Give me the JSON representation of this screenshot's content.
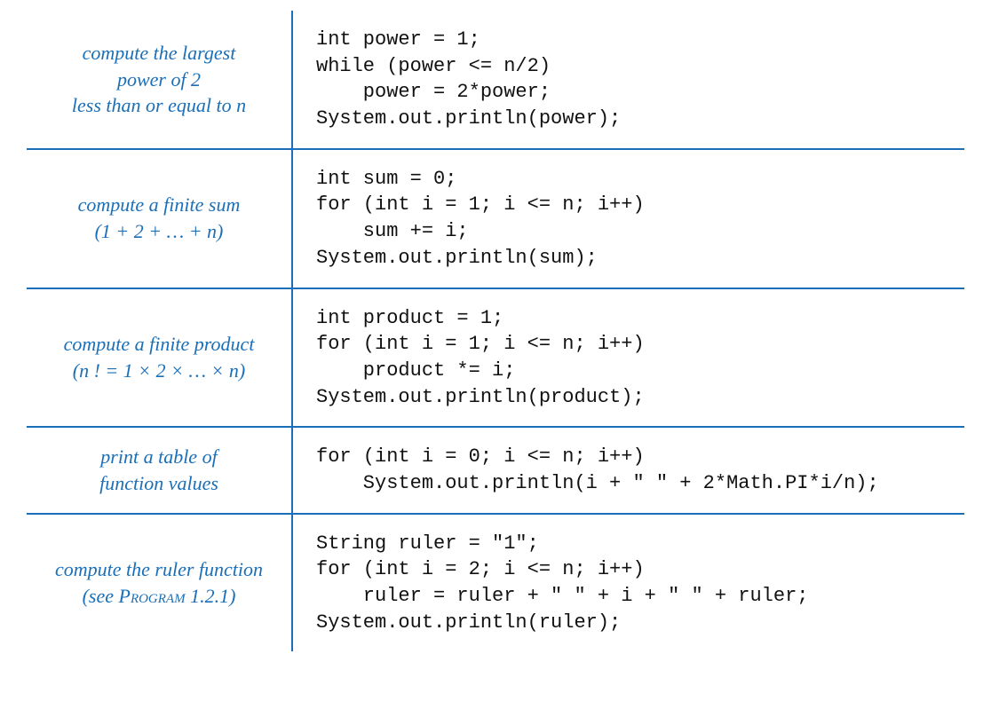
{
  "rows": [
    {
      "desc_html": "compute the largest<br>power of 2<br>less than or equal to n",
      "code": "int power = 1;\nwhile (power <= n/2)\n    power = 2*power;\nSystem.out.println(power);"
    },
    {
      "desc_html": "compute a finite sum<br>(1 + 2 + … + n)",
      "code": "int sum = 0;\nfor (int i = 1; i <= n; i++)\n    sum += i;\nSystem.out.println(sum);"
    },
    {
      "desc_html": "compute a finite product<br>(n ! = 1 × 2 ×  …  × n)",
      "code": "int product = 1;\nfor (int i = 1; i <= n; i++)\n    product *= i;\nSystem.out.println(product);"
    },
    {
      "desc_html": "print a table of<br>function values",
      "code": "for (int i = 0; i <= n; i++)\n    System.out.println(i + \" \" + 2*Math.PI*i/n);"
    },
    {
      "desc_html": "compute the ruler function<br>(see <span class=\"smallcaps\">Program</span> 1.2.1)",
      "code": "String ruler = \"1\";\nfor (int i = 2; i <= n; i++)\n    ruler = ruler + \" \" + i + \" \" + ruler;\nSystem.out.println(ruler);"
    }
  ]
}
